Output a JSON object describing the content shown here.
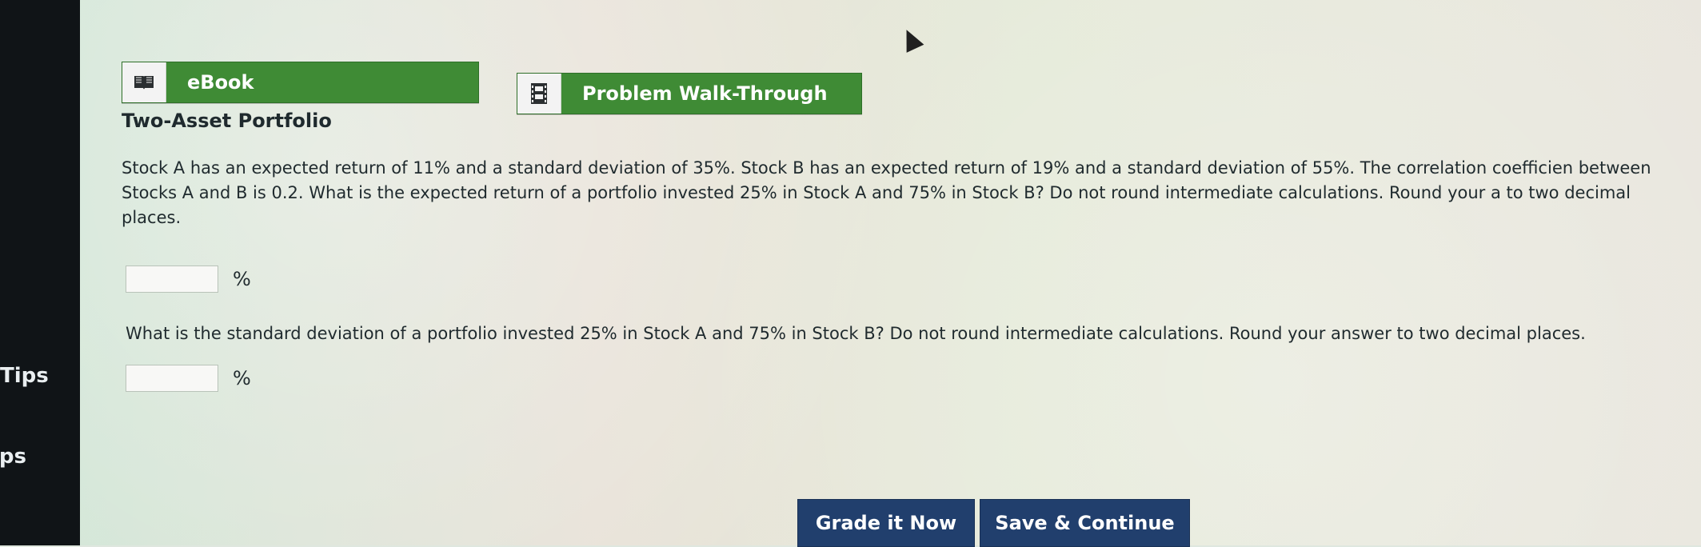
{
  "left_rail": {
    "label_1": "Tips",
    "label_2": "ips"
  },
  "toolbar": {
    "ebook_label": "eBook",
    "walkthrough_label": "Problem Walk-Through",
    "ebook_icon": "book-icon",
    "walkthrough_icon": "film-strip-icon"
  },
  "content": {
    "title": "Two-Asset Portfolio",
    "question_1": "Stock A has an expected return of 11% and a standard deviation of 35%. Stock B has an expected return of 19% and a standard deviation of 55%. The correlation coefficien between Stocks A and B is 0.2. What is the expected return of a portfolio invested 25% in Stock A and 75% in Stock B? Do not round intermediate calculations. Round your a to two decimal places.",
    "answer_1_value": "",
    "answer_1_unit": "%",
    "question_2": "What is the standard deviation of a portfolio invested 25% in Stock A and 75% in Stock B? Do not round intermediate calculations. Round your answer to two decimal places.",
    "answer_2_value": "",
    "answer_2_unit": "%"
  },
  "actions": {
    "grade_label": "Grade it Now",
    "save_label": "Save & Continue"
  },
  "colors": {
    "toolbar_green": "#3f8b35",
    "action_blue": "#213f6d"
  }
}
